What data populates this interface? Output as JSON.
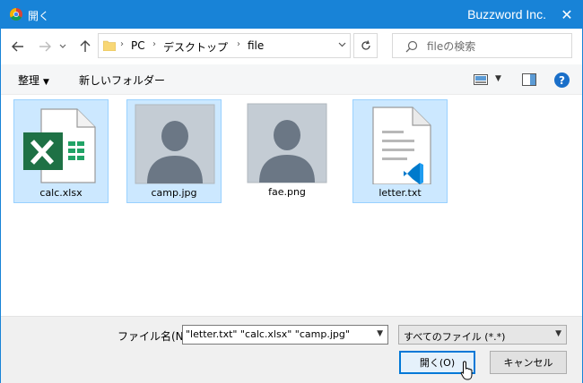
{
  "titlebar": {
    "title": "開く",
    "brand": "Buzzword Inc.",
    "close_glyph": "✕",
    "accent_color": "#1883d7"
  },
  "nav": {
    "back_icon": "arrow-left-icon",
    "forward_icon": "arrow-right-icon",
    "recent_icon": "chevron-down-icon",
    "up_icon": "arrow-up-icon",
    "breadcrumb": [
      "PC",
      "デスクトップ",
      "file"
    ],
    "refresh_icon": "refresh-icon",
    "search_placeholder": "fileの検索"
  },
  "toolbar": {
    "organize_label": "整理",
    "new_folder_label": "新しいフォルダー",
    "help_glyph": "?"
  },
  "files": [
    {
      "name": "calc.xlsx",
      "icon": "excel-file-icon",
      "selected": true
    },
    {
      "name": "camp.jpg",
      "icon": "image-placeholder-icon",
      "selected": true
    },
    {
      "name": "fae.png",
      "icon": "image-placeholder-icon",
      "selected": false
    },
    {
      "name": "letter.txt",
      "icon": "text-file-vscode-icon",
      "selected": true
    }
  ],
  "footer": {
    "filename_label": "ファイル名(N):",
    "filename_value": "\"letter.txt\" \"calc.xlsx\" \"camp.jpg\"",
    "filetype_value": "すべてのファイル (*.*)",
    "open_label": "開く(O)",
    "cancel_label": "キャンセル"
  }
}
